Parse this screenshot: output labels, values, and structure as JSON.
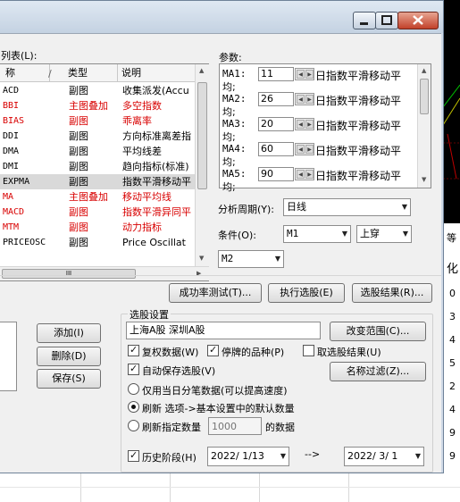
{
  "list_caption": "列表(L):",
  "columns": [
    "称",
    "/",
    "类型",
    "说明"
  ],
  "indicators": [
    {
      "code": "ACD",
      "type": "副图",
      "desc": "收集派发(Accu",
      "color": "normal"
    },
    {
      "code": "BBI",
      "type": "主图叠加",
      "desc": "多空指数",
      "color": "red"
    },
    {
      "code": "BIAS",
      "type": "副图",
      "desc": "乖离率",
      "color": "red"
    },
    {
      "code": "DDI",
      "type": "副图",
      "desc": "方向标准离差指",
      "color": "normal"
    },
    {
      "code": "DMA",
      "type": "副图",
      "desc": "平均线差",
      "color": "normal"
    },
    {
      "code": "DMI",
      "type": "副图",
      "desc": "趋向指标(标准)",
      "color": "normal"
    },
    {
      "code": "EXPMA",
      "type": "副图",
      "desc": "指数平滑移动平",
      "color": "selected"
    },
    {
      "code": "MA",
      "type": "主图叠加",
      "desc": "移动平均线",
      "color": "red"
    },
    {
      "code": "MACD",
      "type": "副图",
      "desc": "指数平滑异同平",
      "color": "red"
    },
    {
      "code": "MTM",
      "type": "副图",
      "desc": "动力指标",
      "color": "red"
    },
    {
      "code": "PRICEOSC",
      "type": "副图",
      "desc": "Price Oscillat",
      "color": "normal"
    }
  ],
  "list_hscroll_grip": "III",
  "params_caption": "参数:",
  "params": [
    {
      "label": "MA1:",
      "value": "11",
      "desc": "日指数平滑移动平",
      "desc2": "均;"
    },
    {
      "label": "MA2:",
      "value": "26",
      "desc": "日指数平滑移动平",
      "desc2": "均;"
    },
    {
      "label": "MA3:",
      "value": "20",
      "desc": "日指数平滑移动平",
      "desc2": "均;"
    },
    {
      "label": "MA4:",
      "value": "60",
      "desc": "日指数平滑移动平",
      "desc2": "均;"
    },
    {
      "label": "MA5:",
      "value": "90",
      "desc": "日指数平滑移动平",
      "desc2": "均;"
    }
  ],
  "period_label": "分析周期(Y):",
  "period_value": "日线",
  "condition_label": "条件(O):",
  "condition_value": "M1",
  "condition_op": "上穿",
  "condition_target": "M2",
  "buttons": {
    "success_test": "成功率测试(T)...",
    "run_select": "执行选股(E)",
    "select_result": "选股结果(R)...",
    "add": "添加(I)",
    "delete": "删除(D)",
    "save": "保存(S)",
    "change_range": "改变范围(C)...",
    "name_filter": "名称过滤(Z)..."
  },
  "settings_caption": "选股设置",
  "range_text": "上海A股   深圳A股",
  "checks": {
    "rights": "复权数据(W)",
    "suspended": "停牌的品种(P)",
    "take_result": "取选股结果(U)",
    "autosave": "自动保存选股(V)"
  },
  "radios": {
    "tick_only": "仅用当日分笔数据(可以提高速度)",
    "refresh_default": "刷新 选项->基本设置中的默认数量",
    "refresh_custom": "刷新指定数量"
  },
  "custom_count_placeholder": "1000",
  "custom_count_suffix": "的数据",
  "history_label": "历史阶段(H)",
  "date_from": "2022/ 1/13",
  "date_arrow": "-->",
  "date_to": "2022/ 3/ 1",
  "bg_side_texts": [
    "等",
    "化",
    "0",
    "3",
    "4",
    "5",
    "2",
    "4",
    "9",
    "9"
  ],
  "colors": {
    "red": "#d80000",
    "title_gradient_top": "#dfe8f2",
    "window_bg": "#f0f0f0"
  }
}
